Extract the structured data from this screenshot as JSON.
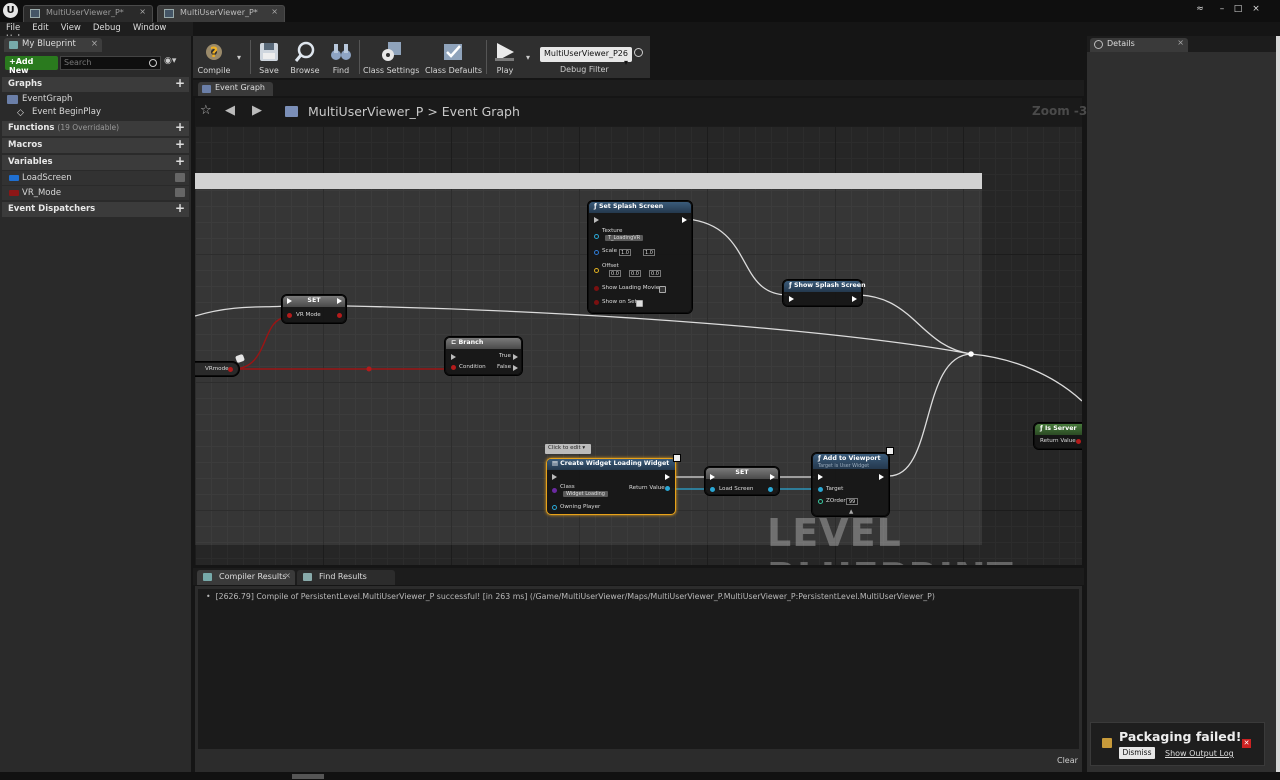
{
  "window": {
    "tabs": [
      {
        "label": "MultiUserViewer_P*",
        "close": "×"
      },
      {
        "label": "MultiUserViewer_P*",
        "close": "×"
      }
    ],
    "controls": {
      "min": "–",
      "max": "□",
      "close": "×"
    }
  },
  "menu": {
    "items": [
      "File",
      "Edit",
      "View",
      "Debug",
      "Window",
      "Help"
    ]
  },
  "my_blueprint": {
    "tab_label": "My Blueprint",
    "add_new": "+Add New",
    "search_placeholder": "Search",
    "sections": {
      "graphs": "Graphs",
      "functions": "Functions",
      "functions_sub": "(19 Overridable)",
      "macros": "Macros",
      "variables": "Variables",
      "event_dispatchers": "Event Dispatchers"
    },
    "graph_items": [
      {
        "label": "EventGraph"
      },
      {
        "label": "Event BeginPlay"
      }
    ],
    "variables": [
      {
        "label": "LoadScreen",
        "color": "#1f6fd1"
      },
      {
        "label": "VR_Mode",
        "color": "#8c1616"
      }
    ]
  },
  "toolbar": {
    "compile": "Compile",
    "save": "Save",
    "browse": "Browse",
    "find": "Find",
    "class_settings": "Class Settings",
    "class_defaults": "Class Defaults",
    "play": "Play",
    "debug_object": "MultiUserViewer_P26",
    "debug_filter": "Debug Filter"
  },
  "graph": {
    "tab_label": "Event Graph",
    "breadcrumb_root": "MultiUserViewer_P",
    "breadcrumb_sep": ">",
    "breadcrumb_leaf": "Event Graph",
    "zoom": "Zoom -3",
    "watermark": "LEVEL BLUEPRINT",
    "nodes": {
      "set_vr": {
        "title": "SET",
        "pin": "VR Mode"
      },
      "vrmode_get": {
        "label": "VRmode"
      },
      "branch": {
        "title": "Branch",
        "condition": "Condition",
        "true_label": "True",
        "false_label": "False"
      },
      "splash": {
        "title": "Set Splash Screen",
        "texture": "Texture",
        "texture_value": "T_LoadingVR",
        "scale": "Scale",
        "scale_x": "1.0",
        "scale_y": "1.0",
        "offset": "Offset",
        "offset_x": "0.0",
        "offset_y": "0.0",
        "offset_z": "0.0",
        "show_loading_movie": "Show Loading Movie",
        "show_on_set": "Show on Set"
      },
      "show_splash": {
        "title": "Show Splash Screen"
      },
      "create_widget": {
        "comment": "Click to edit",
        "title": "Create Widget Loading Widget",
        "class": "Class",
        "class_value": "Widget Loading",
        "return_value": "Return Value",
        "owning_player": "Owning Player"
      },
      "set_load": {
        "title": "SET",
        "pin": "Load Screen"
      },
      "add_viewport": {
        "title": "Add to Viewport",
        "subtitle": "Target is User Widget",
        "target": "Target",
        "zorder": "ZOrder",
        "zorder_value": "99"
      },
      "is_server": {
        "title": "Is Server",
        "return_value": "Return Value"
      }
    }
  },
  "results": {
    "tabs": [
      "Compiler Results",
      "Find Results"
    ],
    "log_line": "[2626.79] Compile of PersistentLevel.MultiUserViewer_P successful! [in 263 ms] (/Game/MultiUserViewer/Maps/MultiUserViewer_P.MultiUserViewer_P:PersistentLevel.MultiUserViewer_P)",
    "clear": "Clear"
  },
  "details": {
    "tab_label": "Details"
  },
  "toast": {
    "title": "Packaging failed!",
    "dismiss": "Dismiss",
    "link": "Show Output Log"
  }
}
